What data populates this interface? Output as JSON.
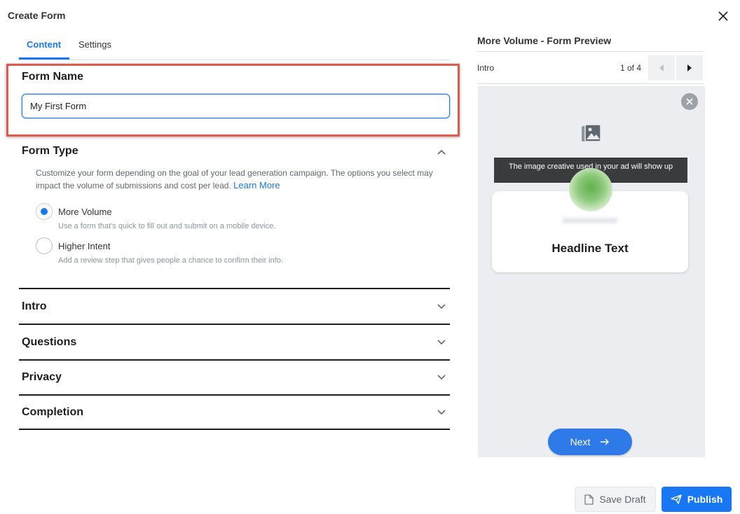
{
  "dialog": {
    "title": "Create Form"
  },
  "tabs": [
    {
      "label": "Content",
      "active": true
    },
    {
      "label": "Settings",
      "active": false
    }
  ],
  "form_name": {
    "label": "Form Name",
    "value": "My First Form"
  },
  "form_type": {
    "title": "Form Type",
    "description": "Customize your form depending on the goal of your lead generation campaign. The options you select may impact the volume of submissions and cost per lead.",
    "learn_more": "Learn More",
    "options": [
      {
        "label": "More Volume",
        "sub": "Use a form that's quick to fill out and submit on a mobile device.",
        "selected": true
      },
      {
        "label": "Higher Intent",
        "sub": "Add a review step that gives people a chance to confirm their info.",
        "selected": false
      }
    ]
  },
  "sections": [
    {
      "title": "Intro"
    },
    {
      "title": "Questions"
    },
    {
      "title": "Privacy"
    },
    {
      "title": "Completion"
    }
  ],
  "preview": {
    "title": "More Volume - Form Preview",
    "step": "Intro",
    "count": "1 of 4",
    "tooltip": "The image creative used in your ad will show up",
    "headline": "Headline Text",
    "next_label": "Next"
  },
  "footer": {
    "save_draft": "Save Draft",
    "publish": "Publish"
  },
  "colors": {
    "accent": "#1877f2",
    "highlight_border": "#e05a4e"
  }
}
